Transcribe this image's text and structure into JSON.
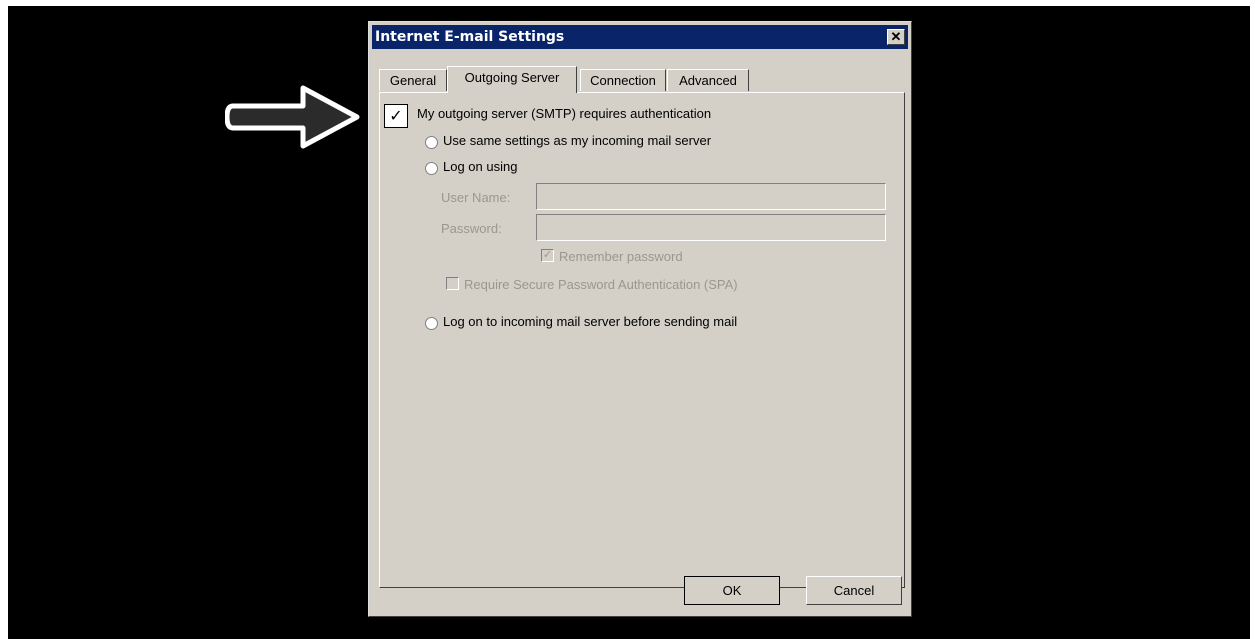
{
  "window": {
    "title": "Internet E-mail Settings",
    "close_glyph": "✕"
  },
  "tabs": [
    {
      "label": "General",
      "active": false
    },
    {
      "label": "Outgoing Server",
      "active": true
    },
    {
      "label": "Connection",
      "active": false
    },
    {
      "label": "Advanced",
      "active": false
    }
  ],
  "outgoing": {
    "requires_auth_label": "My outgoing server (SMTP) requires authentication",
    "requires_auth_checked": true,
    "check_glyph": "✓",
    "option_same_settings": "Use same settings as my incoming mail server",
    "option_log_on_using": "Log on using",
    "user_name_label": "User Name:",
    "user_name_value": "",
    "password_label": "Password:",
    "password_value": "",
    "remember_password_label": "Remember password",
    "remember_password_checked": true,
    "remember_check_glyph": "✓",
    "spa_label": "Require Secure Password Authentication (SPA)",
    "spa_checked": false,
    "option_log_on_incoming": "Log on to incoming mail server before sending mail"
  },
  "buttons": {
    "ok": "OK",
    "cancel": "Cancel"
  },
  "icons": {
    "pointer": "arrow-right-icon"
  },
  "colors": {
    "titlebar": "#0a246a",
    "dialog_bg": "#d4d0c8",
    "disabled_text": "#9a978f"
  }
}
